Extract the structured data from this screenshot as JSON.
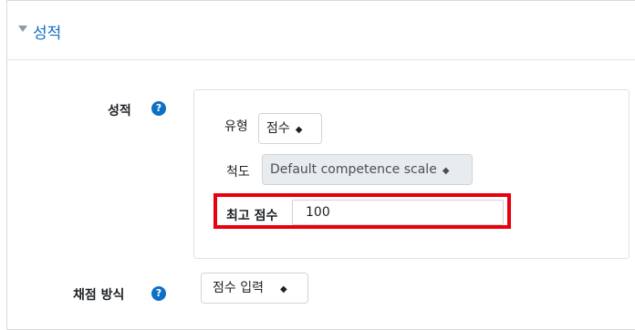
{
  "section": {
    "title": "성적",
    "collapse_icon": "chevron-down-icon"
  },
  "grade": {
    "label": "성적",
    "help_icon": "?",
    "type_label": "유형",
    "type_value": "점수",
    "scale_label": "척도",
    "scale_value": "Default competence scale",
    "max_grade_label": "최고 점수",
    "max_grade_value": "100"
  },
  "grading_method": {
    "label": "채점 방식",
    "help_icon": "?",
    "value": "점수 입력"
  },
  "colors": {
    "accent": "#0f6fc5",
    "highlight": "#e8000c"
  }
}
